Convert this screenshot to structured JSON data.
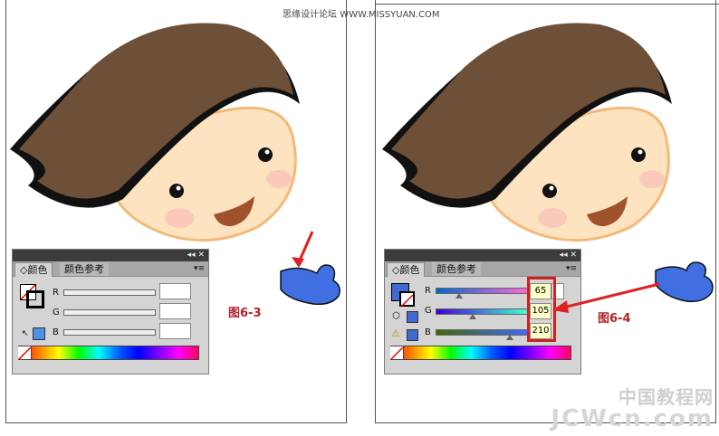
{
  "watermark": "思缘设计论坛 WWW.MISSYUAN.COM",
  "left": {
    "caption": "图6-3",
    "panel": {
      "title_buttons": "◂◂  ✕",
      "tabs": [
        "◇颜色",
        "颜色参考"
      ],
      "menu": "▾≡",
      "labels": [
        "R",
        "G",
        "B"
      ],
      "values": [
        "",
        "",
        ""
      ]
    }
  },
  "right": {
    "caption": "图6-4",
    "panel": {
      "title_buttons": "◂◂  ✕",
      "tabs": [
        "◇颜色",
        "颜色参考"
      ],
      "menu": "▾≡",
      "labels": [
        "R",
        "G",
        "B"
      ],
      "values": [
        "65",
        "105",
        "210"
      ]
    },
    "selected_color": "#4169d2"
  },
  "logo": {
    "cn": "中国教程网",
    "en": "JCWcn.com"
  }
}
